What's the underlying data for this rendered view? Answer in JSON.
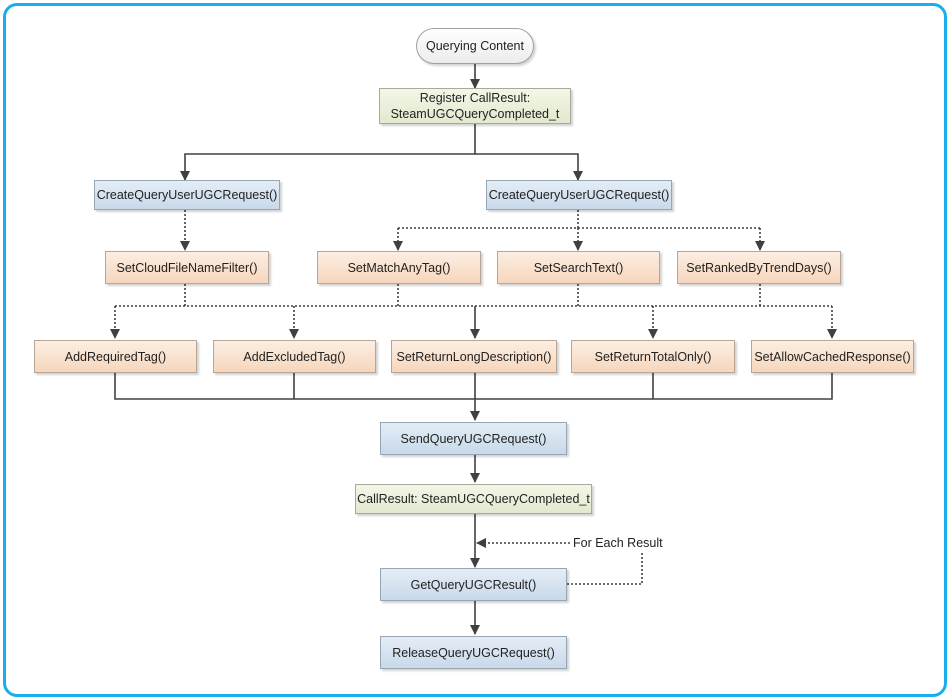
{
  "diagram": {
    "title": "Querying Content",
    "nodes": {
      "start": "Querying Content",
      "register": "Register CallResult:\nSteamUGCQueryCompleted_t",
      "create_left": "CreateQueryUserUGCRequest()",
      "create_right": "CreateQueryUserUGCRequest()",
      "set_cloud_filter": "SetCloudFileNameFilter()",
      "set_match_any_tag": "SetMatchAnyTag()",
      "set_search_text": "SetSearchText()",
      "set_ranked_by_trend_days": "SetRankedByTrendDays()",
      "add_required_tag": "AddRequiredTag()",
      "add_excluded_tag": "AddExcludedTag()",
      "set_return_long_description": "SetReturnLongDescription()",
      "set_return_total_only": "SetReturnTotalOnly()",
      "set_allow_cached_response": "SetAllowCachedResponse()",
      "send_query": "SendQueryUGCRequest()",
      "callresult": "CallResult: SteamUGCQueryCompleted_t",
      "get_result": "GetQueryUGCResult()",
      "release_request": "ReleaseQueryUGCRequest()"
    },
    "loop_label": "For Each Result",
    "colors": {
      "frame": "#1aaeea",
      "terminal": "#f2f2f2",
      "callresult": "#e8eed8",
      "api_call": "#d3e1ee",
      "optional_setter": "#f9dfca",
      "edge": "#404040"
    }
  }
}
